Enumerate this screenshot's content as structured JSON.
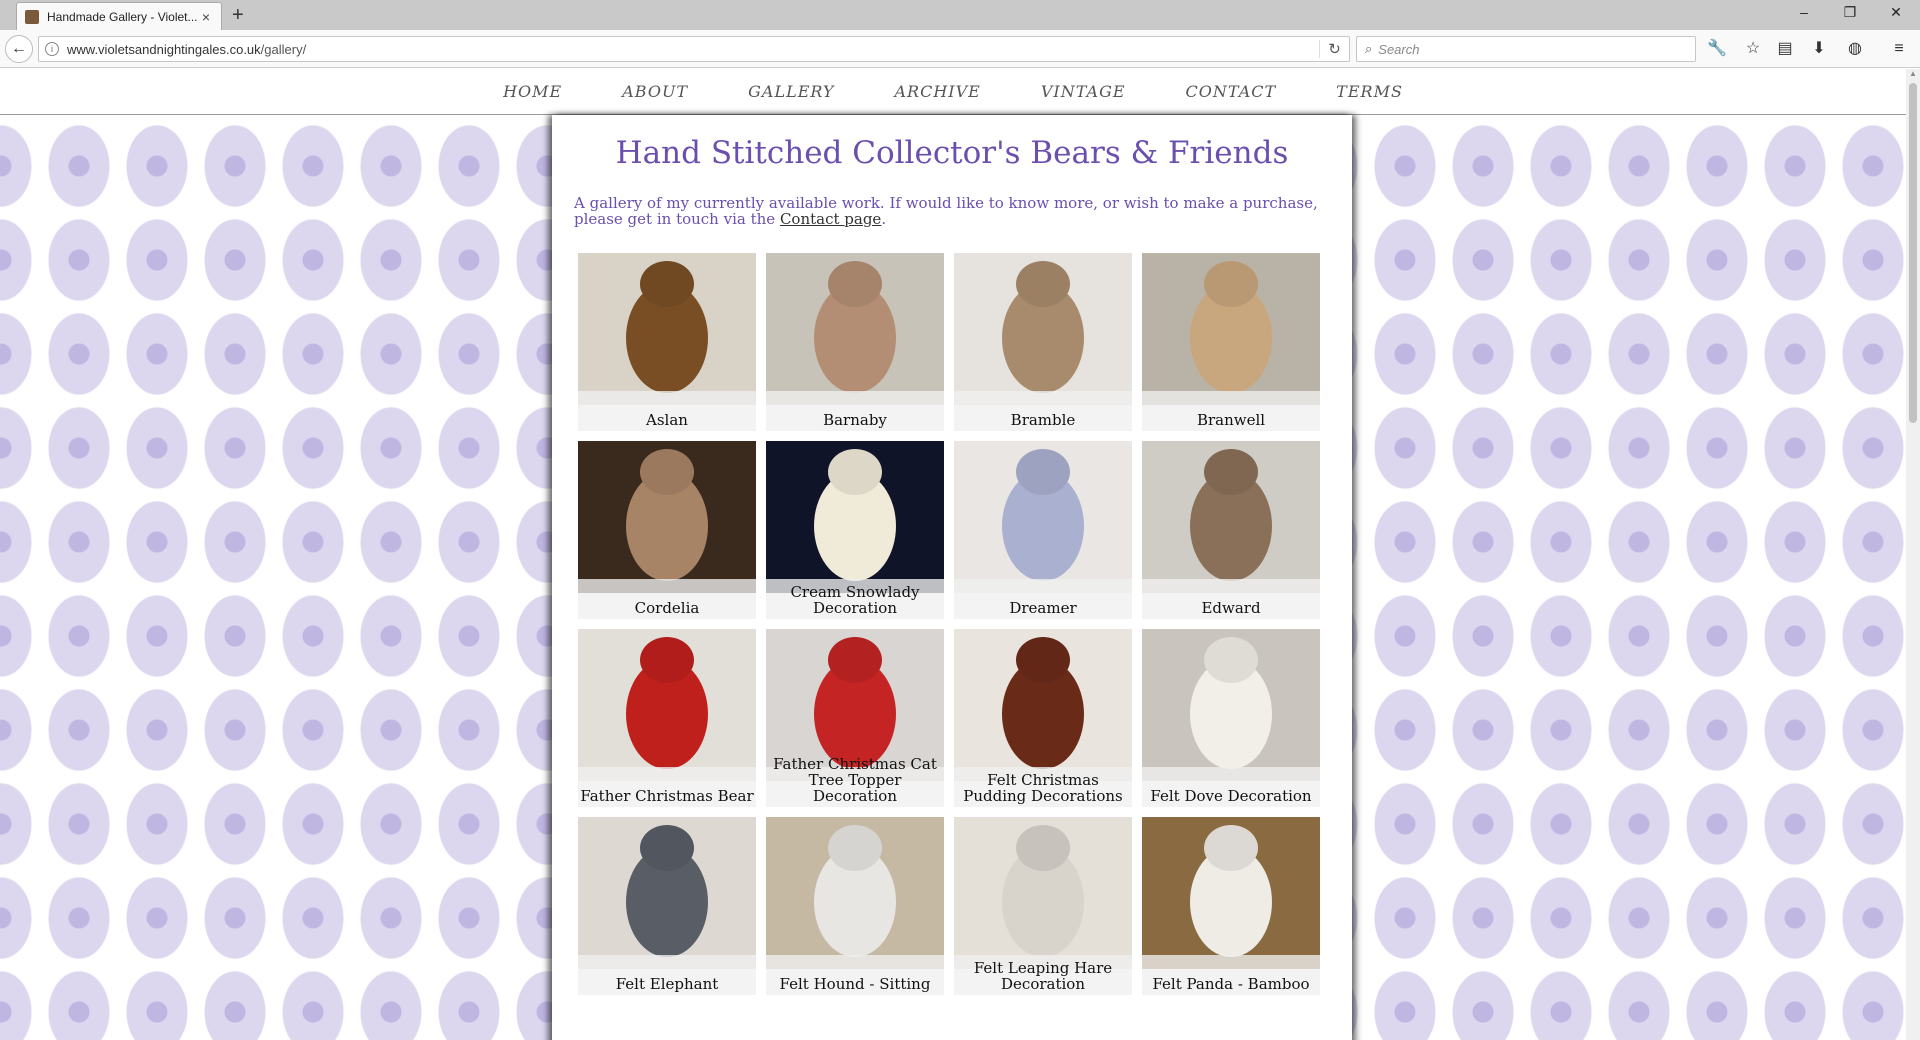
{
  "browser": {
    "tab_title": "Handmade Gallery - Violet...",
    "tab_close": "×",
    "new_tab": "+",
    "url_host": "www.violetsandnightingales.co.uk",
    "url_path": "/gallery/",
    "search_placeholder": "Search",
    "window_controls": [
      "–",
      "❐",
      "✕"
    ]
  },
  "site_nav": [
    "HOME",
    "ABOUT",
    "GALLERY",
    "ARCHIVE",
    "VINTAGE",
    "CONTACT",
    "TERMS"
  ],
  "page": {
    "title": "Hand Stitched Collector's Bears & Friends",
    "intro_text": "A gallery of my currently available work. If would like to know more, or wish to make a purchase, please get in touch via the ",
    "intro_link": "Contact page",
    "intro_end": "."
  },
  "gallery": [
    {
      "name": "Aslan",
      "bg": "#d9d2c6",
      "fg": "#7a4e25"
    },
    {
      "name": "Barnaby",
      "bg": "#c8c3b8",
      "fg": "#b48e74"
    },
    {
      "name": "Bramble",
      "bg": "#e6e2de",
      "fg": "#a88b6c"
    },
    {
      "name": "Branwell",
      "bg": "#b9b2a6",
      "fg": "#c8a67e"
    },
    {
      "name": "Cordelia",
      "bg": "#3a2a1e",
      "fg": "#a88466"
    },
    {
      "name": "Cream Snowlady Decoration",
      "bg": "#101428",
      "fg": "#f0ead8"
    },
    {
      "name": "Dreamer",
      "bg": "#e9e6e4",
      "fg": "#aab0d0"
    },
    {
      "name": "Edward",
      "bg": "#cfccc6",
      "fg": "#8a7058"
    },
    {
      "name": "Father Christmas Bear",
      "bg": "#e2dfd8",
      "fg": "#c0201c"
    },
    {
      "name": "Father Christmas Cat Tree Topper Decoration",
      "bg": "#d8d5d2",
      "fg": "#c42424"
    },
    {
      "name": "Felt Christmas Pudding Decorations",
      "bg": "#e9e4dd",
      "fg": "#6a2a18"
    },
    {
      "name": "Felt Dove Decoration",
      "bg": "#c9c4bd",
      "fg": "#f2efe8"
    },
    {
      "name": "Felt Elephant",
      "bg": "#ddd9d2",
      "fg": "#595d66"
    },
    {
      "name": "Felt Hound - Sitting",
      "bg": "#c6b9a4",
      "fg": "#e8e6e2"
    },
    {
      "name": "Felt Leaping Hare Decoration",
      "bg": "#e4e0d8",
      "fg": "#d8d4cc"
    },
    {
      "name": "Felt Panda - Bamboo",
      "bg": "#8a6a40",
      "fg": "#efece6"
    }
  ]
}
